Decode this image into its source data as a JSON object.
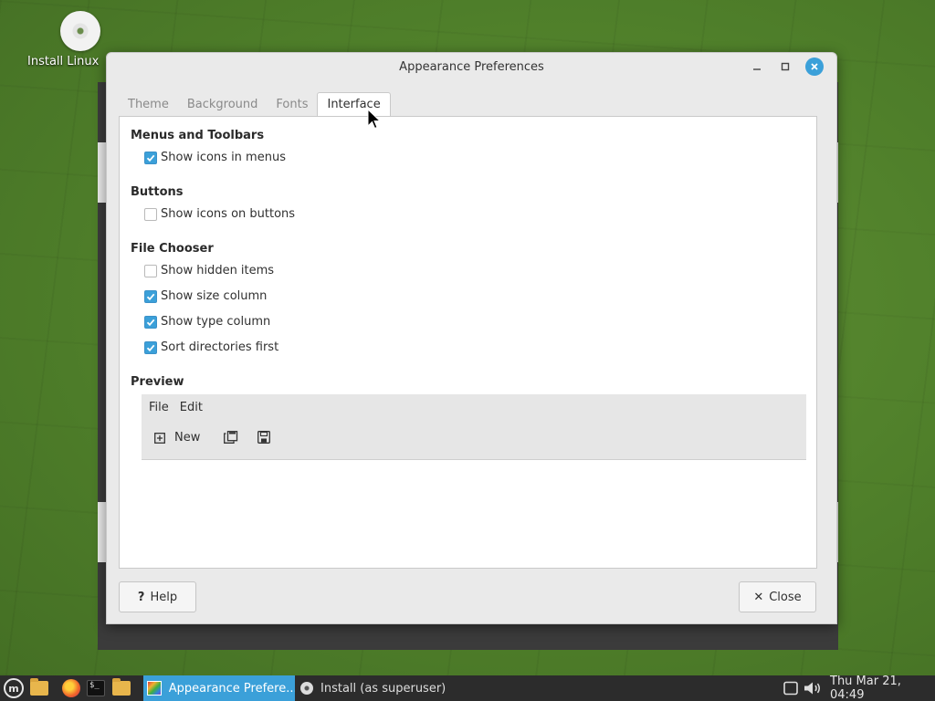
{
  "desktop": {
    "icons": [
      {
        "label": "Install Linux",
        "icon": "disc-icon"
      }
    ]
  },
  "dialog": {
    "title": "Appearance Preferences",
    "window_controls": [
      "minimize",
      "maximize",
      "close"
    ],
    "tabs": [
      {
        "label": "Theme",
        "active": false
      },
      {
        "label": "Background",
        "active": false
      },
      {
        "label": "Fonts",
        "active": false
      },
      {
        "label": "Interface",
        "active": true
      }
    ],
    "sections": {
      "menus": {
        "title": "Menus and Toolbars",
        "options": [
          {
            "label": "Show icons in menus",
            "checked": true
          }
        ]
      },
      "buttons": {
        "title": "Buttons",
        "options": [
          {
            "label": "Show icons on buttons",
            "checked": false
          }
        ]
      },
      "file_chooser": {
        "title": "File Chooser",
        "options": [
          {
            "label": "Show hidden items",
            "checked": false
          },
          {
            "label": "Show size column",
            "checked": true
          },
          {
            "label": "Show type column",
            "checked": true
          },
          {
            "label": "Sort directories first",
            "checked": true
          }
        ]
      },
      "preview": {
        "title": "Preview",
        "menu": [
          "File",
          "Edit"
        ],
        "toolbar_new_label": "New"
      }
    },
    "help_label": "Help",
    "close_label": "Close",
    "accent_color": "#3ba0d9"
  },
  "taskbar": {
    "tasks": [
      {
        "label": "Appearance Prefere...",
        "active": true
      },
      {
        "label": "Install (as superuser)",
        "active": false
      }
    ],
    "clock": "Thu Mar 21, 04:49"
  }
}
